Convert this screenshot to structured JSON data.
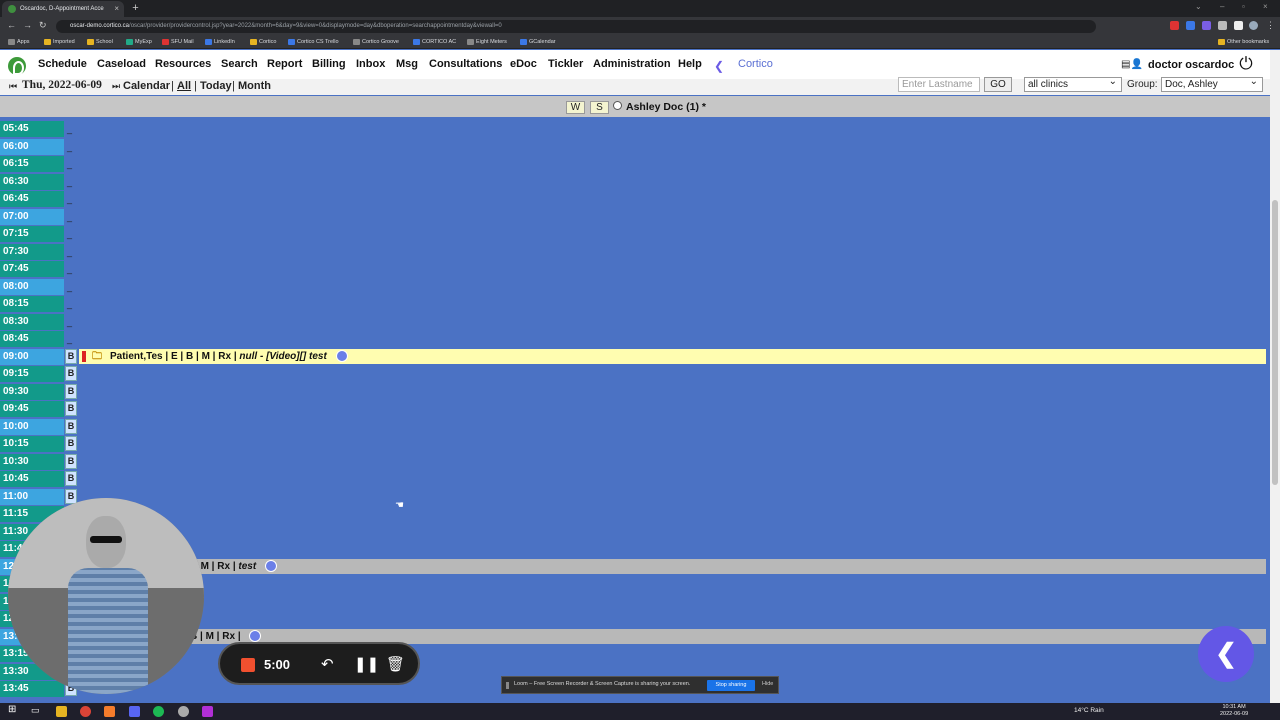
{
  "browser": {
    "tab_title": "Oscardoc, D-Appointment Acce",
    "url_host": "oscar-demo.cortico.ca",
    "url_path": "/oscar/provider/providercontrol.jsp?year=2022&month=6&day=9&view=0&displaymode=day&dboperation=searchappointmentday&viewall=0",
    "bookmarks": [
      "Apps",
      "Imported",
      "School",
      "MyExp",
      "SFU Mail",
      "LinkedIn",
      "Cortico",
      "Cortico CS Trello",
      "Cortico Groove",
      "CORTICO AC",
      "Eight Meters",
      "GCalendar"
    ],
    "other_bookmarks": "Other bookmarks"
  },
  "menu": {
    "items": [
      "Schedule",
      "Caseload",
      "Resources",
      "Search",
      "Report",
      "Billing",
      "Inbox",
      "Msg",
      "Consultations",
      "eDoc",
      "Tickler",
      "Administration",
      "Help"
    ],
    "cortico": "Cortico",
    "user": "doctor oscardoc"
  },
  "datebar": {
    "date": "Thu, 2022-06-09",
    "calendar": "Calendar",
    "all": "All",
    "today": "Today",
    "month": "Month",
    "lastname_placeholder": "Enter Lastname",
    "go": "GO",
    "clinic": "all clinics",
    "group_label": "Group:",
    "group": "Doc, Ashley"
  },
  "provider": {
    "w": "W",
    "s": "S",
    "name": "Ashley Doc (1) *"
  },
  "schedule": {
    "times": [
      {
        "t": "05:45",
        "c": "g",
        "m": "_"
      },
      {
        "t": "06:00",
        "c": "b",
        "m": "_"
      },
      {
        "t": "06:15",
        "c": "g",
        "m": "_"
      },
      {
        "t": "06:30",
        "c": "g",
        "m": "_"
      },
      {
        "t": "06:45",
        "c": "g",
        "m": "_"
      },
      {
        "t": "07:00",
        "c": "b",
        "m": "_"
      },
      {
        "t": "07:15",
        "c": "g",
        "m": "_"
      },
      {
        "t": "07:30",
        "c": "g",
        "m": "_"
      },
      {
        "t": "07:45",
        "c": "g",
        "m": "_"
      },
      {
        "t": "08:00",
        "c": "b",
        "m": "_"
      },
      {
        "t": "08:15",
        "c": "g",
        "m": "_"
      },
      {
        "t": "08:30",
        "c": "g",
        "m": "_"
      },
      {
        "t": "08:45",
        "c": "g",
        "m": "_"
      },
      {
        "t": "09:00",
        "c": "b",
        "m": "B"
      },
      {
        "t": "09:15",
        "c": "g",
        "m": "B"
      },
      {
        "t": "09:30",
        "c": "g",
        "m": "B"
      },
      {
        "t": "09:45",
        "c": "g",
        "m": "B"
      },
      {
        "t": "10:00",
        "c": "b",
        "m": "B"
      },
      {
        "t": "10:15",
        "c": "g",
        "m": "B"
      },
      {
        "t": "10:30",
        "c": "g",
        "m": "B"
      },
      {
        "t": "10:45",
        "c": "g",
        "m": "B"
      },
      {
        "t": "11:00",
        "c": "b",
        "m": "B"
      },
      {
        "t": "11:15",
        "c": "g",
        "m": ""
      },
      {
        "t": "11:30",
        "c": "g",
        "m": ""
      },
      {
        "t": "11:45",
        "c": "g",
        "m": ""
      },
      {
        "t": "12:00",
        "c": "b",
        "m": ""
      },
      {
        "t": "12:15",
        "c": "g",
        "m": ""
      },
      {
        "t": "12:30",
        "c": "g",
        "m": ""
      },
      {
        "t": "12:45",
        "c": "g",
        "m": ""
      },
      {
        "t": "13:00",
        "c": "b",
        "m": ""
      },
      {
        "t": "13:15",
        "c": "g",
        "m": ""
      },
      {
        "t": "13:30",
        "c": "g",
        "m": ""
      },
      {
        "t": "13:45",
        "c": "g",
        "m": "B"
      }
    ],
    "appt1": {
      "patient": "Patient,Tes",
      "links": "| E | B | M | Rx |",
      "note": "null - [Video][] test"
    },
    "appt2": {
      "links": "| M | Rx |",
      "note": "test"
    },
    "appt3": {
      "links": "B | M | Rx |"
    }
  },
  "recorder": {
    "time": "5:00"
  },
  "sharing": {
    "text": "Loom – Free Screen Recorder & Screen Capture is sharing your screen.",
    "stop": "Stop sharing",
    "hide": "Hide"
  },
  "taskbar": {
    "weather": "14°C  Rain",
    "time": "10:31 AM",
    "date": "2022-06-09"
  }
}
